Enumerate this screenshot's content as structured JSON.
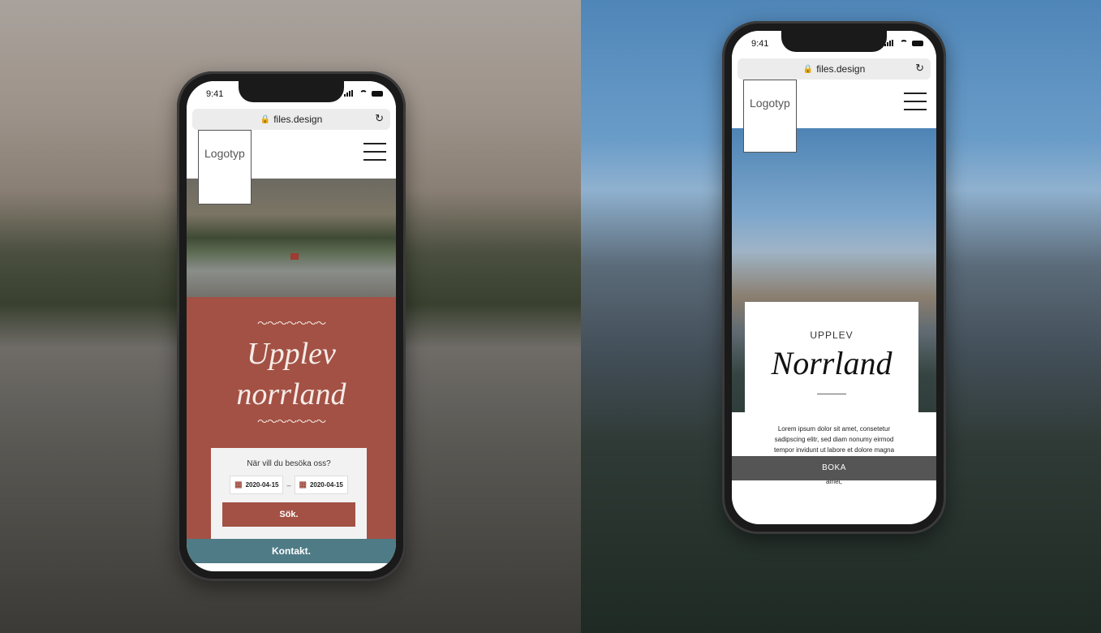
{
  "phone1": {
    "status": {
      "time": "9:41"
    },
    "url": "files.design",
    "logo": "Logotyp",
    "hero_title_line1": "Upplev",
    "hero_title_line2": "norrland",
    "wave": "〜〜〜〜〜〜〜",
    "booking": {
      "question": "När vill du besöka oss?",
      "date_from": "2020-04-15",
      "separator": "–",
      "date_to": "2020-04-15",
      "search_button": "Sök."
    },
    "footer_button": "Kontakt.",
    "colors": {
      "brick": "#a35145",
      "teal": "#4e7b86"
    }
  },
  "phone2": {
    "status": {
      "time": "9:41"
    },
    "url": "files.design",
    "logo": "Logotyp",
    "card": {
      "pre_title": "UPPLEV",
      "title": "Norrland"
    },
    "body": "Lorem ipsum dolor sit amet, consetetur sadipscing elitr, sed diam nonumy eirmod tempor invidunt ut labore et dolore magna aliquyam erat, sed diam voluptua. At vero eos et accusam et justo duo, orem ipsum dolor sit amet,",
    "footer_button": "BOKA"
  },
  "icons": [
    "lock-icon",
    "reload-icon",
    "hamburger-menu-icon",
    "calendar-icon",
    "signal-icon",
    "wifi-icon",
    "battery-icon"
  ]
}
